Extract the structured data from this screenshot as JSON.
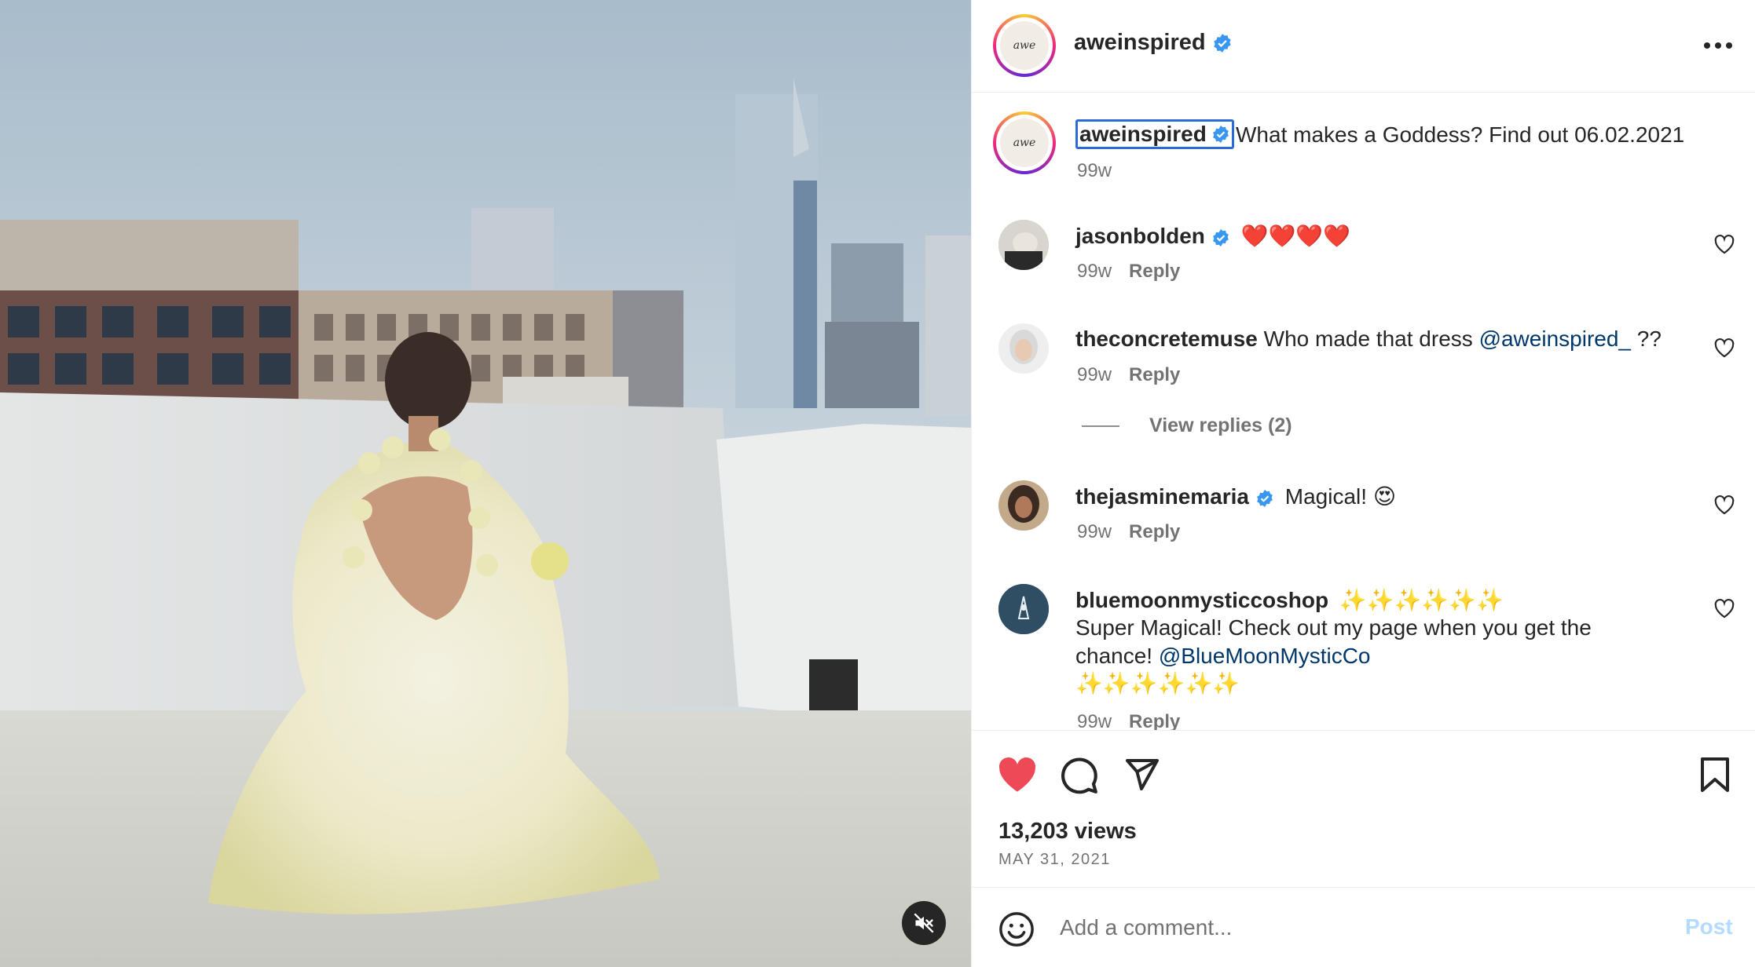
{
  "post": {
    "author": "aweinspired",
    "avatar_text": "awe",
    "verified": true
  },
  "caption": {
    "username": "aweinspired",
    "text": "What makes a Goddess? Find out 06.02.2021",
    "time": "99w"
  },
  "comments": [
    {
      "username": "jasonbolden",
      "verified": true,
      "text": "❤️❤️❤️❤️",
      "time": "99w",
      "reply_label": "Reply"
    },
    {
      "username": "theconcretemuse",
      "verified": false,
      "text": "Who made that dress ",
      "mention": "@aweinspired_",
      "text_after": " ??",
      "time": "99w",
      "reply_label": "Reply",
      "view_replies": "View replies (2)"
    },
    {
      "username": "thejasminemaria",
      "verified": true,
      "text": "Magical! 😍",
      "time": "99w",
      "reply_label": "Reply"
    },
    {
      "username": "bluemoonmysticcoshop",
      "verified": false,
      "text": "✨✨✨✨✨✨",
      "line2": "Super Magical! Check out my page when you get the",
      "line3_prefix": "chance! ",
      "mention": "@BlueMoonMysticCo",
      "line4": "✨✨✨✨✨✨",
      "time": "99w",
      "reply_label": "Reply"
    }
  ],
  "stats": {
    "views": "13,203 views",
    "date": "MAY 31, 2021"
  },
  "add_comment": {
    "placeholder": "Add a comment...",
    "post_label": "Post"
  },
  "icons": {
    "like": "heart-filled-icon",
    "comment": "comment-bubble-icon",
    "share": "paper-plane-icon",
    "save": "bookmark-icon",
    "more": "more-horizontal-icon",
    "mute": "speaker-muted-icon",
    "emoji": "smiley-icon"
  },
  "colors": {
    "like_red": "#ed4956",
    "verified_blue": "#3897f0",
    "link_blue": "#00376b",
    "post_disabled": "#b3dbff",
    "caption_highlight": "#2b6bd8"
  }
}
